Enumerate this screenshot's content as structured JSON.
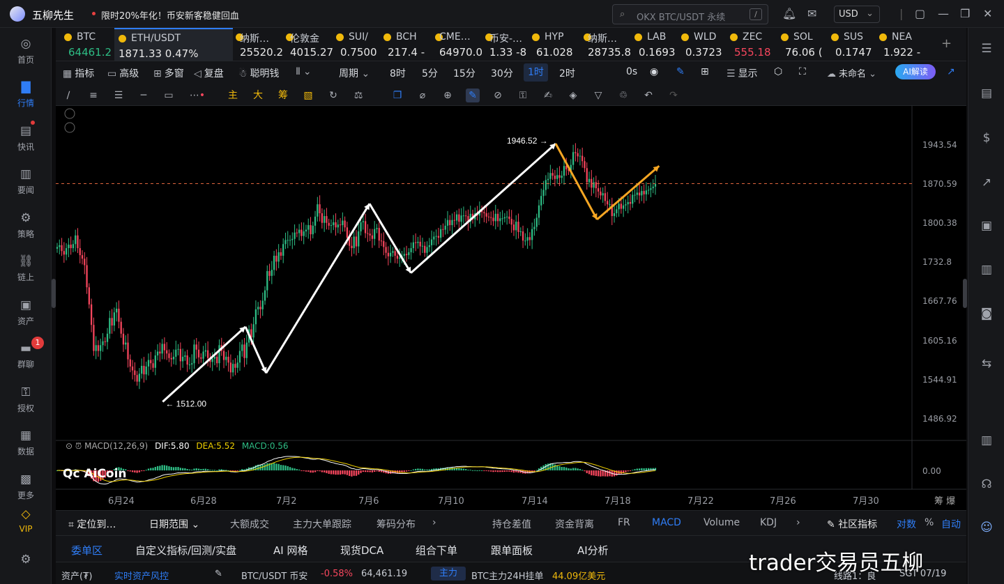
{
  "app": {
    "name": "五柳先生",
    "promo": "限时20%年化！币安新客稳健回血"
  },
  "search": {
    "placeholder": "OKX BTC/USDT 永续",
    "shortcut": "/"
  },
  "currency": "USD",
  "left_nav": [
    {
      "label": "首页",
      "icon": "home-icon"
    },
    {
      "label": "行情",
      "icon": "market-icon",
      "active": true
    },
    {
      "label": "快讯",
      "icon": "news-flash-icon"
    },
    {
      "label": "要闻",
      "icon": "headlines-icon"
    },
    {
      "label": "策略",
      "icon": "strategy-icon"
    },
    {
      "label": "链上",
      "icon": "onchain-icon"
    },
    {
      "label": "资产",
      "icon": "wallet-icon"
    },
    {
      "label": "群聊",
      "icon": "chat-icon"
    },
    {
      "label": "授权",
      "icon": "key-icon"
    },
    {
      "label": "数据",
      "icon": "data-icon"
    },
    {
      "label": "更多",
      "icon": "more-grid-icon"
    },
    {
      "label": "VIP",
      "icon": "vip-diamond-icon"
    }
  ],
  "chat_badge": "1",
  "tickers": [
    {
      "name": "BTC",
      "price": "64461.2",
      "dir": "up"
    },
    {
      "name": "ETH/USDT",
      "price": "1871.33  0.47%",
      "dir": "nt",
      "selected": true
    },
    {
      "name": "纳斯…",
      "price": "25520.2",
      "dir": "nt"
    },
    {
      "name": "伦敦金",
      "price": "4015.27",
      "dir": "nt"
    },
    {
      "name": "SUI/",
      "price": "0.7500",
      "dir": "nt"
    },
    {
      "name": "BCH",
      "price": "217.4 -",
      "dir": "nt"
    },
    {
      "name": "CME…",
      "price": "64970.0",
      "dir": "nt"
    },
    {
      "name": "币安-…",
      "price": "1.33 -8",
      "dir": "nt"
    },
    {
      "name": "HYP",
      "price": "61.028",
      "dir": "nt"
    },
    {
      "name": "纳斯…",
      "price": "28735.8",
      "dir": "nt"
    },
    {
      "name": "LAB",
      "price": "0.1693",
      "dir": "nt"
    },
    {
      "name": "WLD",
      "price": "0.3723",
      "dir": "nt"
    },
    {
      "name": "ZEC",
      "price": "555.18",
      "dir": "dn"
    },
    {
      "name": "SOL",
      "price": "76.06 (",
      "dir": "nt"
    },
    {
      "name": "SUS",
      "price": "0.1747",
      "dir": "nt"
    },
    {
      "name": "NEA",
      "price": "1.922 -",
      "dir": "nt"
    }
  ],
  "toolbar1": {
    "indicators": "指标",
    "advanced": "高级",
    "multi_window": "多窗",
    "replay": "复盘",
    "smart_money": "聪明钱",
    "period": "周期",
    "intervals": [
      "8时",
      "5分",
      "15分",
      "30分",
      "1时",
      "2时"
    ],
    "selected_interval": "1时",
    "countdown": "0s",
    "display": "显示",
    "layout_name": "未命名",
    "ai_read": "AI解读"
  },
  "toolbar2": {
    "main": "主",
    "large": "大",
    "chips": "筹"
  },
  "chart_data": {
    "type": "candlestick",
    "symbol": "ETH/USDT",
    "interval": "1时",
    "y_ticks": [
      1943.54,
      1870.59,
      1800.38,
      1732.8,
      1667.76,
      1605.16,
      1544.91,
      1486.92
    ],
    "x_ticks": [
      "6月24",
      "6月28",
      "7月2",
      "7月6",
      "7月10",
      "7月14",
      "7月18",
      "7月22",
      "7月26",
      "7月30"
    ],
    "current_price": 1871.33,
    "annotations": [
      {
        "label": "1512.00",
        "value": 1512.0,
        "date": "6月26"
      },
      {
        "label": "1946.52",
        "value": 1946.52,
        "date": "7月15"
      }
    ],
    "white_path": [
      {
        "date": "6月26",
        "price": 1512
      },
      {
        "date": "6月30",
        "price": 1627
      },
      {
        "date": "7月1",
        "price": 1555
      },
      {
        "date": "7月6",
        "price": 1835
      },
      {
        "date": "7月8",
        "price": 1715
      },
      {
        "date": "7月15",
        "price": 1946
      }
    ],
    "orange_path": [
      {
        "date": "7月15",
        "price": 1946
      },
      {
        "date": "7月17",
        "price": 1807
      },
      {
        "date": "7月20",
        "price": 1904
      }
    ],
    "close_series": [
      1759,
      1762,
      1752,
      1746,
      1757,
      1763,
      1757,
      1764,
      1779,
      1757,
      1745,
      1739,
      1728,
      1691,
      1663,
      1630,
      1589,
      1598,
      1589,
      1598,
      1604,
      1603,
      1616,
      1641,
      1629,
      1650,
      1656,
      1635,
      1616,
      1599,
      1602,
      1576,
      1565,
      1559,
      1552,
      1542,
      1554,
      1566,
      1553,
      1565,
      1575,
      1570,
      1563,
      1582,
      1588,
      1585,
      1600,
      1590,
      1585,
      1578,
      1576,
      1580,
      1591,
      1592,
      1573,
      1580,
      1582,
      1568,
      1568,
      1570,
      1599,
      1591,
      1579,
      1577,
      1588,
      1590,
      1578,
      1572,
      1577,
      1580,
      1570,
      1598,
      1589,
      1575,
      1580,
      1571,
      1556,
      1569,
      1563,
      1571,
      1589,
      1599,
      1578,
      1602,
      1623,
      1610,
      1631,
      1655,
      1659,
      1655,
      1669,
      1686,
      1718,
      1710,
      1720,
      1744,
      1734,
      1750,
      1744,
      1764,
      1771,
      1771,
      1771,
      1773,
      1784,
      1783,
      1789,
      1778,
      1786,
      1789,
      1797,
      1781,
      1796,
      1812,
      1834,
      1818,
      1801,
      1813,
      1801,
      1796,
      1797,
      1802,
      1793,
      1798,
      1797,
      1805,
      1793,
      1775,
      1761,
      1757,
      1777,
      1760,
      1786,
      1802,
      1804,
      1783,
      1782,
      1779,
      1773,
      1790,
      1792,
      1770,
      1769,
      1759,
      1749,
      1743,
      1749,
      1752,
      1744,
      1739,
      1741,
      1744,
      1747,
      1745,
      1750,
      1757,
      1767,
      1766,
      1768,
      1760,
      1761,
      1749,
      1759,
      1762,
      1772,
      1777,
      1778,
      1775,
      1790,
      1789,
      1796,
      1806,
      1797,
      1806,
      1805,
      1816,
      1803,
      1814,
      1814,
      1813,
      1803,
      1817,
      1807,
      1818,
      1814,
      1823,
      1820,
      1818,
      1812,
      1811,
      1810,
      1804,
      1817,
      1804,
      1809,
      1809,
      1811,
      1812,
      1808,
      1798,
      1788,
      1803,
      1785,
      1786,
      1770,
      1770,
      1776,
      1771,
      1790,
      1794,
      1810,
      1832,
      1849,
      1860,
      1878,
      1880,
      1891,
      1886,
      1880,
      1887,
      1882,
      1886,
      1904,
      1898,
      1895,
      1906,
      1930,
      1928,
      1922,
      1923,
      1913,
      1900,
      1874,
      1880,
      1864,
      1874,
      1863,
      1857,
      1850,
      1854,
      1840,
      1834,
      1834,
      1813,
      1818,
      1825,
      1835,
      1826,
      1832,
      1834,
      1838,
      1835,
      1851,
      1851,
      1855,
      1850,
      1858,
      1852,
      1859,
      1860,
      1863,
      1866,
      1871
    ],
    "macd": {
      "params": "MACD(12,26,9)",
      "dif": "5.80",
      "dea": "5.52",
      "macd": "0.56",
      "zero": "0.00"
    }
  },
  "indicator_tabs": {
    "locate": "定位到…",
    "date_range": "日期范围",
    "items": [
      "大额成交",
      "主力大单跟踪",
      "筹码分布",
      "持仓差值",
      "资金背离",
      "FR",
      "MACD",
      "Volume",
      "KDJ"
    ],
    "selected": "MACD",
    "community": "社区指标",
    "log": "对数",
    "percent": "%",
    "auto": "自动"
  },
  "bottom_tabs": [
    "委单区",
    "自定义指标/回测/实盘",
    "AI 网格",
    "现货DCA",
    "组合下单",
    "跟单面板",
    "AI分析"
  ],
  "status": {
    "asset": "资产(₮)",
    "risk": "实时资产风控",
    "pair": "BTC/USDT 币安",
    "change": "-0.58%",
    "price": "64,461.19",
    "main": "主力",
    "flow": "BTC主力24H挂单",
    "flow_value": "44.09亿美元",
    "line": "线路1：良",
    "time": "SGT 07/19"
  },
  "watermark": "trader交易员五柳",
  "colors": {
    "up": "#2ebd85",
    "down": "#f6465d",
    "accent": "#2f7df6",
    "orange": "#f5a623",
    "vip": "#f0b90b"
  }
}
